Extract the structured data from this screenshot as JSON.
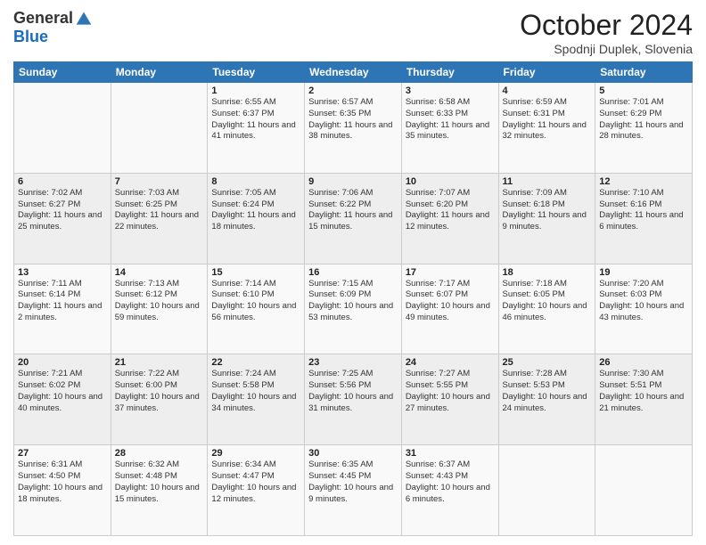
{
  "header": {
    "logo_general": "General",
    "logo_blue": "Blue",
    "month_title": "October 2024",
    "subtitle": "Spodnji Duplek, Slovenia"
  },
  "days_of_week": [
    "Sunday",
    "Monday",
    "Tuesday",
    "Wednesday",
    "Thursday",
    "Friday",
    "Saturday"
  ],
  "weeks": [
    [
      {
        "day": "",
        "info": ""
      },
      {
        "day": "",
        "info": ""
      },
      {
        "day": "1",
        "info": "Sunrise: 6:55 AM\nSunset: 6:37 PM\nDaylight: 11 hours and 41 minutes."
      },
      {
        "day": "2",
        "info": "Sunrise: 6:57 AM\nSunset: 6:35 PM\nDaylight: 11 hours and 38 minutes."
      },
      {
        "day": "3",
        "info": "Sunrise: 6:58 AM\nSunset: 6:33 PM\nDaylight: 11 hours and 35 minutes."
      },
      {
        "day": "4",
        "info": "Sunrise: 6:59 AM\nSunset: 6:31 PM\nDaylight: 11 hours and 32 minutes."
      },
      {
        "day": "5",
        "info": "Sunrise: 7:01 AM\nSunset: 6:29 PM\nDaylight: 11 hours and 28 minutes."
      }
    ],
    [
      {
        "day": "6",
        "info": "Sunrise: 7:02 AM\nSunset: 6:27 PM\nDaylight: 11 hours and 25 minutes."
      },
      {
        "day": "7",
        "info": "Sunrise: 7:03 AM\nSunset: 6:25 PM\nDaylight: 11 hours and 22 minutes."
      },
      {
        "day": "8",
        "info": "Sunrise: 7:05 AM\nSunset: 6:24 PM\nDaylight: 11 hours and 18 minutes."
      },
      {
        "day": "9",
        "info": "Sunrise: 7:06 AM\nSunset: 6:22 PM\nDaylight: 11 hours and 15 minutes."
      },
      {
        "day": "10",
        "info": "Sunrise: 7:07 AM\nSunset: 6:20 PM\nDaylight: 11 hours and 12 minutes."
      },
      {
        "day": "11",
        "info": "Sunrise: 7:09 AM\nSunset: 6:18 PM\nDaylight: 11 hours and 9 minutes."
      },
      {
        "day": "12",
        "info": "Sunrise: 7:10 AM\nSunset: 6:16 PM\nDaylight: 11 hours and 6 minutes."
      }
    ],
    [
      {
        "day": "13",
        "info": "Sunrise: 7:11 AM\nSunset: 6:14 PM\nDaylight: 11 hours and 2 minutes."
      },
      {
        "day": "14",
        "info": "Sunrise: 7:13 AM\nSunset: 6:12 PM\nDaylight: 10 hours and 59 minutes."
      },
      {
        "day": "15",
        "info": "Sunrise: 7:14 AM\nSunset: 6:10 PM\nDaylight: 10 hours and 56 minutes."
      },
      {
        "day": "16",
        "info": "Sunrise: 7:15 AM\nSunset: 6:09 PM\nDaylight: 10 hours and 53 minutes."
      },
      {
        "day": "17",
        "info": "Sunrise: 7:17 AM\nSunset: 6:07 PM\nDaylight: 10 hours and 49 minutes."
      },
      {
        "day": "18",
        "info": "Sunrise: 7:18 AM\nSunset: 6:05 PM\nDaylight: 10 hours and 46 minutes."
      },
      {
        "day": "19",
        "info": "Sunrise: 7:20 AM\nSunset: 6:03 PM\nDaylight: 10 hours and 43 minutes."
      }
    ],
    [
      {
        "day": "20",
        "info": "Sunrise: 7:21 AM\nSunset: 6:02 PM\nDaylight: 10 hours and 40 minutes."
      },
      {
        "day": "21",
        "info": "Sunrise: 7:22 AM\nSunset: 6:00 PM\nDaylight: 10 hours and 37 minutes."
      },
      {
        "day": "22",
        "info": "Sunrise: 7:24 AM\nSunset: 5:58 PM\nDaylight: 10 hours and 34 minutes."
      },
      {
        "day": "23",
        "info": "Sunrise: 7:25 AM\nSunset: 5:56 PM\nDaylight: 10 hours and 31 minutes."
      },
      {
        "day": "24",
        "info": "Sunrise: 7:27 AM\nSunset: 5:55 PM\nDaylight: 10 hours and 27 minutes."
      },
      {
        "day": "25",
        "info": "Sunrise: 7:28 AM\nSunset: 5:53 PM\nDaylight: 10 hours and 24 minutes."
      },
      {
        "day": "26",
        "info": "Sunrise: 7:30 AM\nSunset: 5:51 PM\nDaylight: 10 hours and 21 minutes."
      }
    ],
    [
      {
        "day": "27",
        "info": "Sunrise: 6:31 AM\nSunset: 4:50 PM\nDaylight: 10 hours and 18 minutes."
      },
      {
        "day": "28",
        "info": "Sunrise: 6:32 AM\nSunset: 4:48 PM\nDaylight: 10 hours and 15 minutes."
      },
      {
        "day": "29",
        "info": "Sunrise: 6:34 AM\nSunset: 4:47 PM\nDaylight: 10 hours and 12 minutes."
      },
      {
        "day": "30",
        "info": "Sunrise: 6:35 AM\nSunset: 4:45 PM\nDaylight: 10 hours and 9 minutes."
      },
      {
        "day": "31",
        "info": "Sunrise: 6:37 AM\nSunset: 4:43 PM\nDaylight: 10 hours and 6 minutes."
      },
      {
        "day": "",
        "info": ""
      },
      {
        "day": "",
        "info": ""
      }
    ]
  ]
}
